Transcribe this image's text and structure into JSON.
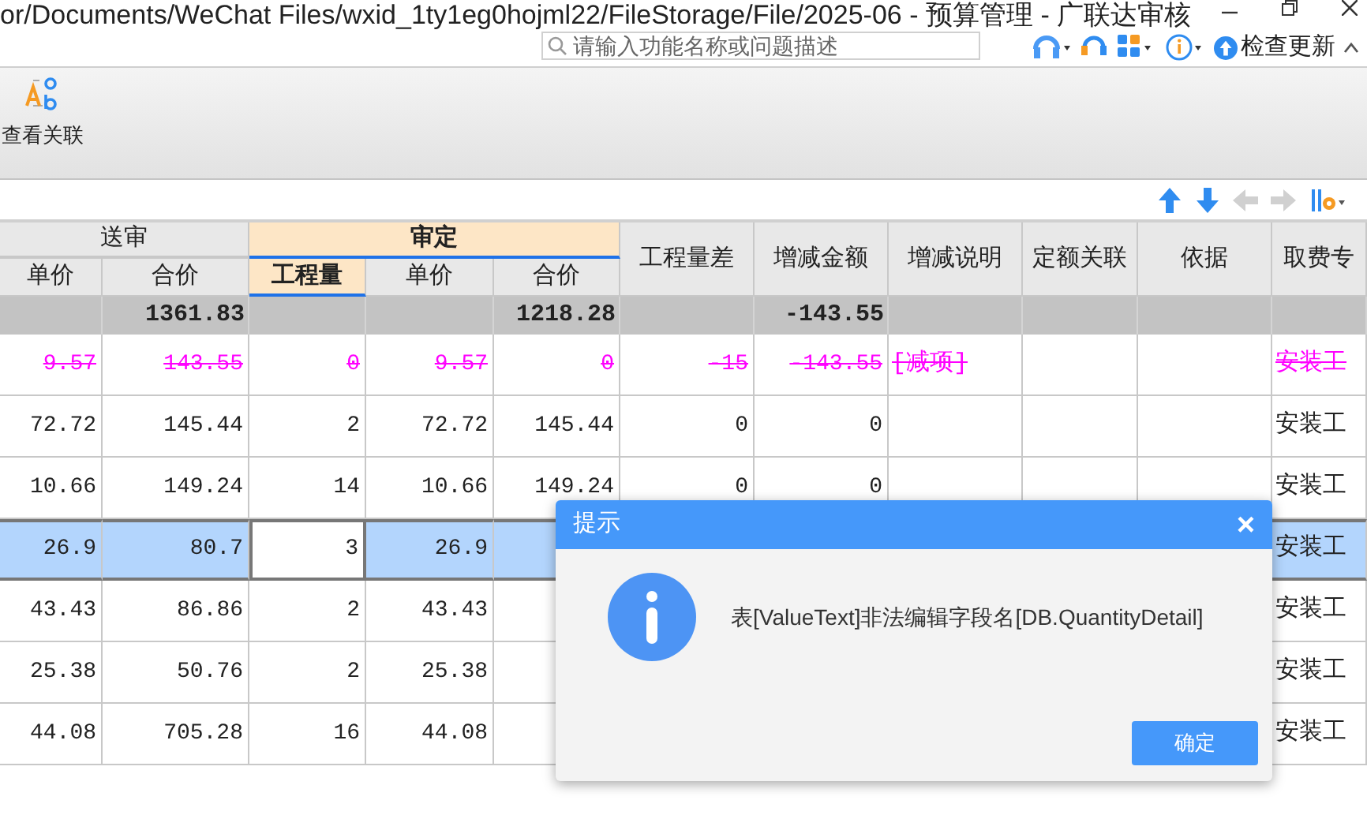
{
  "window": {
    "title": "or/Documents/WeChat Files/wxid_1ty1eg0hojml22/FileStorage/File/2025-06 - 预算管理 - 广联达审核"
  },
  "search": {
    "placeholder": "请输入功能名称或问题描述"
  },
  "update_button": "检查更新",
  "toolbar": [
    {
      "label": "查看关联"
    }
  ],
  "table": {
    "header": [
      {
        "kind": "group",
        "label": "送审",
        "selected": false,
        "columns": [
          {
            "label": "单价",
            "selected": false
          },
          {
            "label": "合价",
            "selected": false
          }
        ]
      },
      {
        "kind": "group",
        "label": "审定",
        "selected": true,
        "columns": [
          {
            "label": "工程量",
            "selected": true
          },
          {
            "label": "单价",
            "selected": false
          },
          {
            "label": "合价",
            "selected": false
          }
        ]
      },
      {
        "kind": "column",
        "label": "工程量差",
        "selected": false
      },
      {
        "kind": "column",
        "label": "增减金额",
        "selected": false
      },
      {
        "kind": "column",
        "label": "增减说明",
        "selected": false
      },
      {
        "kind": "column",
        "label": "定额关联",
        "selected": false
      },
      {
        "kind": "column",
        "label": "依据",
        "selected": false
      },
      {
        "kind": "column",
        "label": "取费专",
        "selected": false
      }
    ],
    "total_row": {
      "submitted_total": "1361.83",
      "approved_total": "1218.28",
      "change_amount": "-143.55"
    },
    "rows": [
      {
        "deleted": true,
        "selected": false,
        "submitted_price": "9.57",
        "submitted_total": "143.55",
        "quantity": "0",
        "approved_price": "9.57",
        "approved_total": "0",
        "quantity_diff": "-15",
        "change_amount": "-143.55",
        "change_note": "[减项]",
        "fee_category": "安装工"
      },
      {
        "deleted": false,
        "selected": false,
        "submitted_price": "72.72",
        "submitted_total": "145.44",
        "quantity": "2",
        "approved_price": "72.72",
        "approved_total": "145.44",
        "quantity_diff": "0",
        "change_amount": "0",
        "fee_category": "安装工"
      },
      {
        "deleted": false,
        "selected": false,
        "submitted_price": "10.66",
        "submitted_total": "149.24",
        "quantity": "14",
        "approved_price": "10.66",
        "approved_total": "149.24",
        "quantity_diff": "0",
        "change_amount": "0",
        "fee_category": "安装工"
      },
      {
        "deleted": false,
        "selected": true,
        "submitted_price": "26.9",
        "submitted_total": "80.7",
        "quantity": "3",
        "approved_price": "26.9",
        "fee_category": "安装工"
      },
      {
        "deleted": false,
        "selected": false,
        "submitted_price": "43.43",
        "submitted_total": "86.86",
        "quantity": "2",
        "approved_price": "43.43",
        "fee_category": "安装工"
      },
      {
        "deleted": false,
        "selected": false,
        "submitted_price": "25.38",
        "submitted_total": "50.76",
        "quantity": "2",
        "approved_price": "25.38",
        "fee_category": "安装工"
      },
      {
        "deleted": false,
        "selected": false,
        "submitted_price": "44.08",
        "submitted_total": "705.28",
        "quantity": "16",
        "approved_price": "44.08",
        "fee_category": "安装工"
      }
    ]
  },
  "dialog": {
    "title": "提示",
    "close": "×",
    "message": "表[ValueText]非法编辑字段名[DB.QuantityDetail]",
    "button": "确定"
  }
}
